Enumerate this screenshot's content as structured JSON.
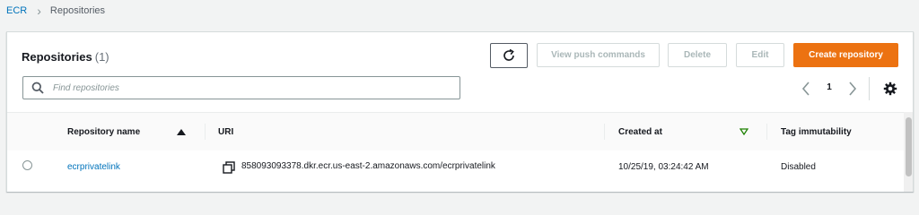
{
  "breadcrumb": {
    "root": "ECR",
    "separator": "›",
    "current": "Repositories"
  },
  "panel": {
    "title": "Repositories",
    "count": "(1)",
    "buttons": {
      "push": "View push commands",
      "delete": "Delete",
      "edit": "Edit",
      "create": "Create repository"
    },
    "search": {
      "placeholder": "Find repositories",
      "value": ""
    },
    "pagination": {
      "current_page": "1"
    }
  },
  "table": {
    "columns": {
      "name": "Repository name",
      "uri": "URI",
      "created": "Created at",
      "tag_immutability": "Tag immutability"
    },
    "rows": [
      {
        "name": "ecrprivatelink",
        "uri": "858093093378.dkr.ecr.us-east-2.amazonaws.com/ecrprivatelink",
        "created": "10/25/19, 03:24:42 AM",
        "tag_immutability": "Disabled"
      }
    ]
  },
  "icons": {
    "refresh": "refresh-icon",
    "search": "search-icon",
    "prev": "chevron-left-icon",
    "next": "chevron-right-icon",
    "settings": "gear-icon",
    "copy": "copy-icon",
    "sort_asc": "sort-ascending-icon",
    "sort_desc": "sort-descending-icon"
  },
  "colors": {
    "accent": "#ec7211",
    "link": "#0073bb"
  }
}
